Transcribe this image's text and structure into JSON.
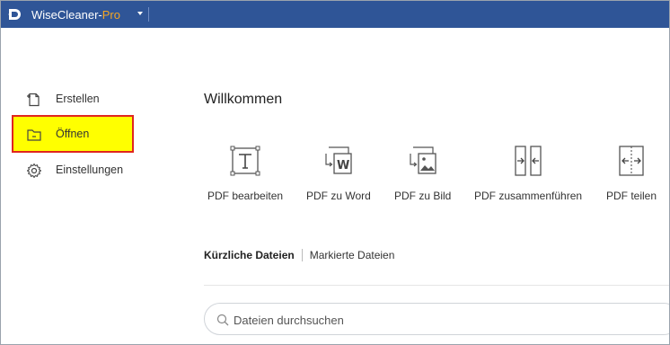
{
  "titlebar": {
    "app_name": "WiseCleaner-",
    "app_suffix": "Pro",
    "accent_color": "#2f5597"
  },
  "sidebar": {
    "items": [
      {
        "label": "Erstellen",
        "icon": "new-file-icon"
      },
      {
        "label": "Öffnen",
        "icon": "folder-open-icon",
        "highlighted": true
      },
      {
        "label": "Einstellungen",
        "icon": "gear-icon"
      }
    ]
  },
  "main": {
    "welcome": "Willkommen",
    "tools": [
      {
        "label": "PDF bearbeiten",
        "icon": "edit-text-icon"
      },
      {
        "label": "PDF zu Word",
        "icon": "pdf-to-word-icon"
      },
      {
        "label": "PDF zu Bild",
        "icon": "pdf-to-image-icon"
      },
      {
        "label": "PDF zusammenführen",
        "icon": "merge-pdf-icon"
      },
      {
        "label": "PDF teilen",
        "icon": "split-pdf-icon"
      }
    ],
    "tabs": {
      "recent": "Kürzliche Dateien",
      "marked": "Markierte Dateien"
    },
    "search": {
      "placeholder": "Dateien durchsuchen"
    }
  }
}
